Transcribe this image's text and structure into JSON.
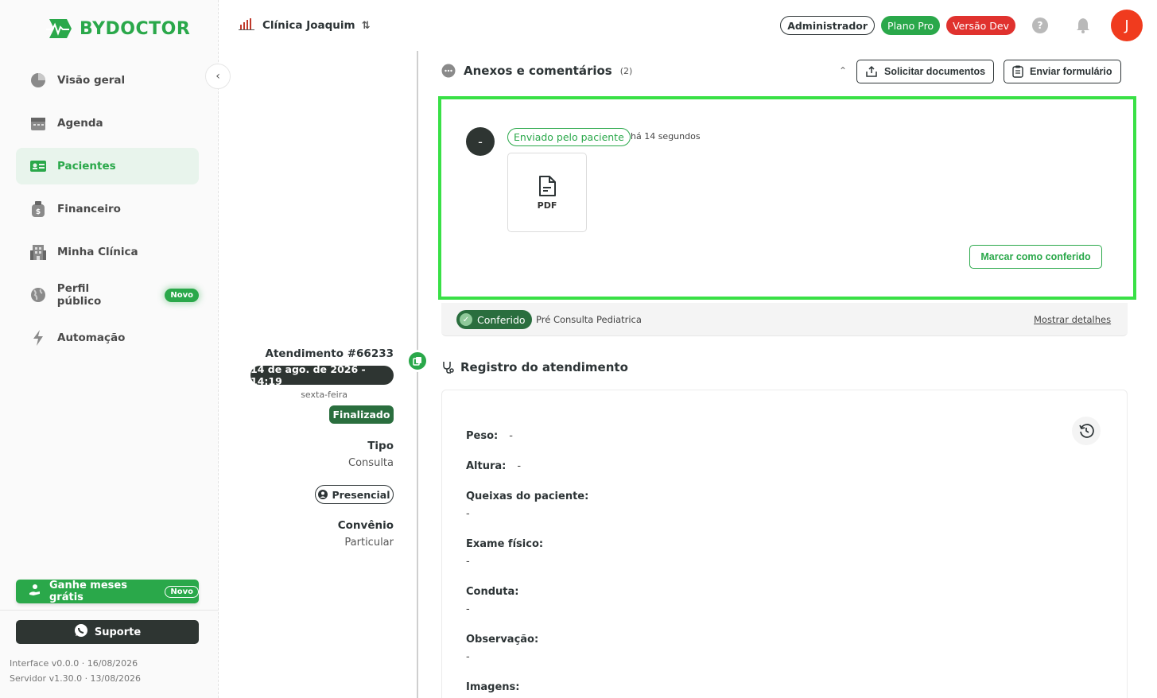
{
  "brand": {
    "name": "BYDOCTOR",
    "color": "#2aa84a"
  },
  "sidebar": {
    "items": [
      {
        "label": "Visão geral",
        "icon": "pie-chart-icon"
      },
      {
        "label": "Agenda",
        "icon": "calendar-icon"
      },
      {
        "label": "Pacientes",
        "icon": "id-card-icon",
        "active": true
      },
      {
        "label": "Financeiro",
        "icon": "money-bag-icon"
      },
      {
        "label": "Minha Clínica",
        "icon": "building-icon"
      },
      {
        "label": "Perfil público",
        "icon": "globe-icon",
        "badge": "Novo"
      },
      {
        "label": "Automação",
        "icon": "lightning-icon"
      }
    ],
    "promo": {
      "label": "Ganhe meses grátis",
      "badge": "Novo"
    },
    "support_label": "Suporte",
    "interface_version": "Interface v0.0.0 · 16/08/2026",
    "server_version": "Servidor v1.30.0 · 13/08/2026"
  },
  "topbar": {
    "clinic": "Clínica Joaquim",
    "role": "Administrador",
    "plan": "Plano Pro",
    "env": "Versão Dev",
    "help": "?",
    "avatar_initial": "J"
  },
  "appointment": {
    "title": "Atendimento #66233",
    "datetime": "14 de ago. de 2026 - 14:19",
    "weekday": "sexta-feira",
    "status": "Finalizado",
    "type_label": "Tipo",
    "type_value": "Consulta",
    "mode": "Presencial",
    "insurance_label": "Convênio",
    "insurance_value": "Particular"
  },
  "attachments": {
    "title": "Anexos e comentários",
    "count": "(2)",
    "request_button": "Solicitar documentos",
    "send_form_button": "Enviar formulário",
    "sender_initial": "-",
    "sender": "Enviado pelo paciente",
    "time_ago": "há 14 segundos",
    "file_type": "PDF",
    "mark_button": "Marcar como conferido",
    "checked_label": "Conferido",
    "form_name": "Pré Consulta Pediatrica",
    "details_link": "Mostrar detalhes"
  },
  "record": {
    "title": "Registro do atendimento",
    "peso_label": "Peso:",
    "peso_value": "-",
    "altura_label": "Altura:",
    "altura_value": "-",
    "queixas_label": "Queixas do paciente:",
    "queixas_value": "-",
    "exame_label": "Exame físico:",
    "exame_value": "-",
    "conduta_label": "Conduta:",
    "conduta_value": "-",
    "obs_label": "Observação:",
    "obs_value": "-",
    "imagens_label": "Imagens:"
  }
}
